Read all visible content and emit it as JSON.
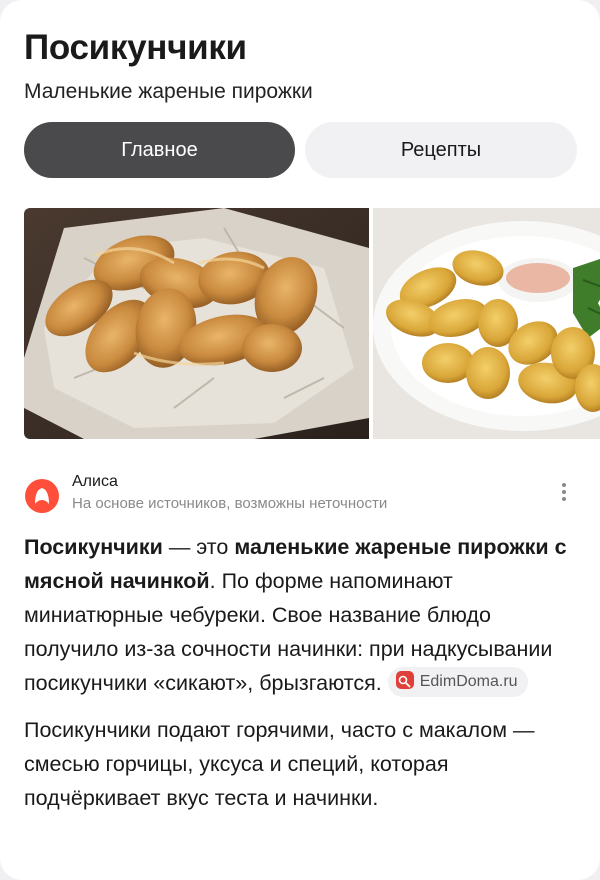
{
  "header": {
    "title": "Посикунчики",
    "subtitle": "Маленькие жареные пирожки"
  },
  "tabs": [
    {
      "label": "Главное",
      "active": true
    },
    {
      "label": "Рецепты",
      "active": false
    }
  ],
  "gallery": {
    "images": [
      {
        "name": "fried-pies-on-paper"
      },
      {
        "name": "fried-pies-plate-with-sauce"
      }
    ]
  },
  "source": {
    "name": "Алиса",
    "note": "На основе источников, возможны неточности",
    "logo_color": "#ff4f3a"
  },
  "answer": {
    "p1": {
      "bold1": "Посикунчики",
      "t1": " — это ",
      "bold2": "маленькие жареные пирожки с мясной начинкой",
      "t2": ". По форме напоминают миниатюрные чебуреки. Свое название блюдо получило из-за сочности начинки: при надкусывании посикунчики «сикают», брызгаются.",
      "chip": "EdimDoma.ru",
      "chip_icon_color": "#e0403a"
    },
    "p2": "Посикунчики подают горячими, часто с макалом — смесью горчицы, уксуса и специй, которая подчёркивает вкус теста и начинки."
  },
  "colors": {
    "active_tab": "#4a4a4c",
    "inactive_tab": "#f1f1f3",
    "muted_text": "#8a8a8e"
  }
}
